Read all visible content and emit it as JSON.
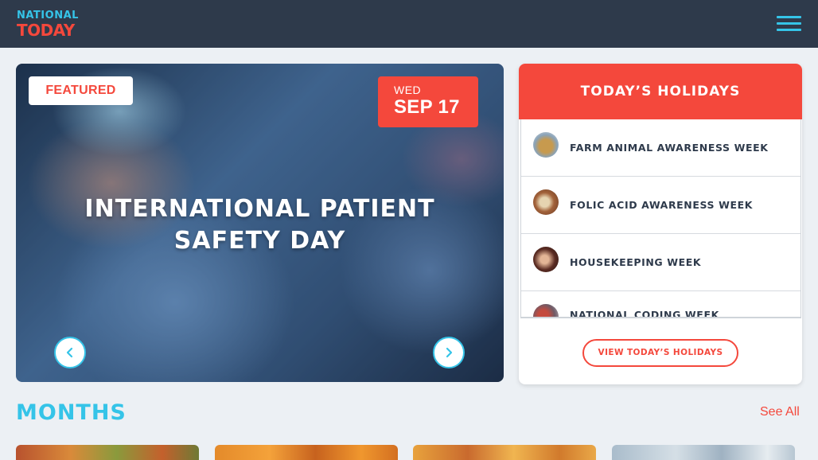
{
  "header": {
    "logo_line1": "NATIONAL",
    "logo_line2": "TODAY",
    "menu_icon": "hamburger-menu-icon"
  },
  "featured": {
    "badge": "FEATURED",
    "weekday": "WED",
    "date": "SEP 17",
    "title": "INTERNATIONAL PATIENT SAFETY DAY",
    "prev_icon": "chevron-left-icon",
    "next_icon": "chevron-right-icon"
  },
  "todays_holidays": {
    "heading": "TODAY’S HOLIDAYS",
    "items": [
      {
        "label": "FARM ANIMAL AWARENESS WEEK"
      },
      {
        "label": "FOLIC ACID AWARENESS WEEK"
      },
      {
        "label": "HOUSEKEEPING WEEK"
      },
      {
        "label": "NATIONAL CODING WEEK"
      }
    ],
    "button": "VIEW TODAY’S HOLIDAYS"
  },
  "months": {
    "heading": "MONTHS",
    "see_all": "See All"
  },
  "colors": {
    "accent_red": "#f4483c",
    "accent_cyan": "#35c4e8",
    "header_bg": "#2e3a4b",
    "page_bg": "#ecf0f4"
  }
}
